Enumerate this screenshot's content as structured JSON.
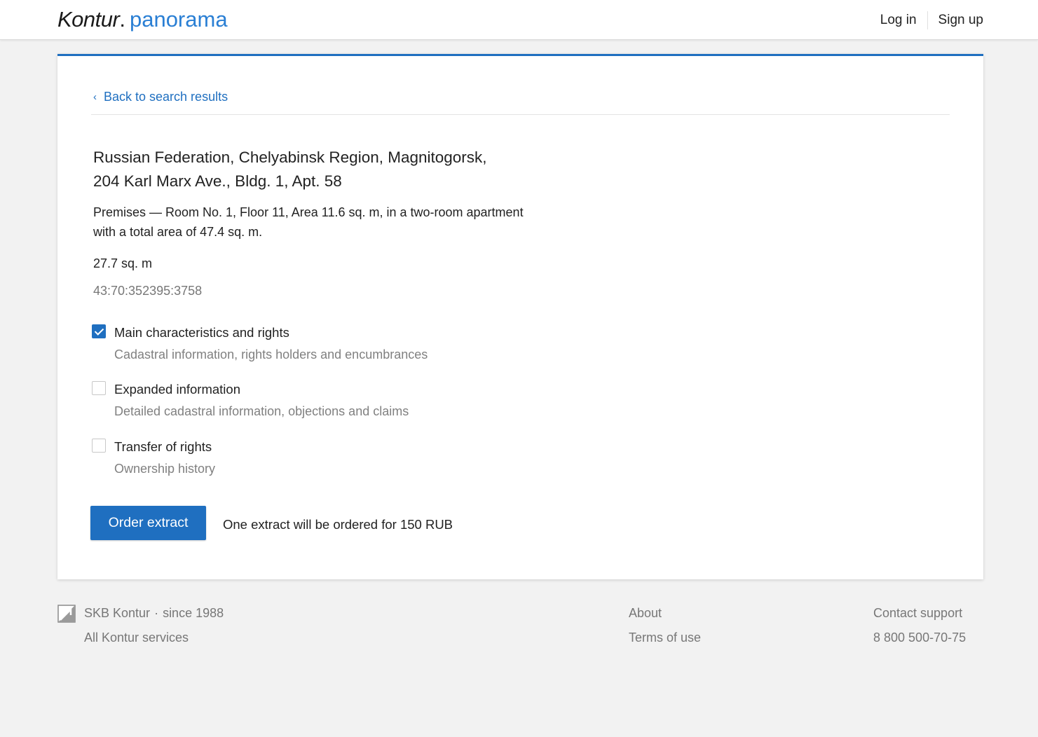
{
  "header": {
    "logo_brand": "Kontur",
    "logo_dot": ".",
    "logo_product": "panorama",
    "login_label": "Log in",
    "signup_label": "Sign up"
  },
  "card": {
    "back_link": "Back to search results",
    "address_line1": "Russian Federation, Chelyabinsk Region, Magnitogorsk,",
    "address_line2": "204 Karl Marx Ave., Bldg. 1, Apt. 58",
    "description": "Premises — Room No. 1, Floor 11, Area 11.6 sq. m, in a two-room apartment with a total area of 47.4 sq. m.",
    "area": "27.7 sq. m",
    "cadastral_number": "43:70:352395:3758",
    "options": [
      {
        "title": "Main characteristics and rights",
        "subtitle": "Cadastral information, rights holders and encumbrances",
        "checked": true
      },
      {
        "title": "Expanded information",
        "subtitle": "Detailed cadastral information, objections and claims",
        "checked": false
      },
      {
        "title": "Transfer of rights",
        "subtitle": "Ownership history",
        "checked": false
      }
    ],
    "order_button": "Order extract",
    "order_note": "One extract will be ordered for 150 RUB"
  },
  "footer": {
    "company": "SKB Kontur",
    "separator": "·",
    "since": "since 1988",
    "all_services": "All Kontur services",
    "about": "About",
    "terms": "Terms of use",
    "contact": "Contact support",
    "phone": "8 800 500-70-75"
  },
  "colors": {
    "accent": "#1f6fc0",
    "logo_product": "#2a7fd4",
    "background": "#f2f2f2",
    "muted_text": "#777777"
  },
  "icons": {
    "back": "chevron-left-icon",
    "checked": "checkmark-icon",
    "footer_logo": "skb-kontur-logo-icon"
  }
}
